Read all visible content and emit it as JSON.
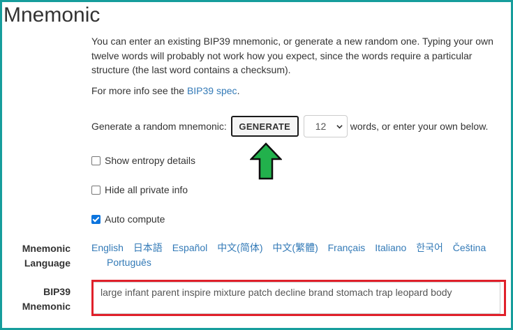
{
  "section": {
    "title": "Mnemonic"
  },
  "intro": {
    "text": "You can enter an existing BIP39 mnemonic, or generate a new random one. Typing your own twelve words will probably not work how you expect, since the words require a particular structure (the last word contains a checksum).",
    "more_info_prefix": "For more info see the ",
    "more_info_link": "BIP39 spec",
    "more_info_suffix": "."
  },
  "generate": {
    "prefix": "Generate a random mnemonic:",
    "button_label": "GENERATE",
    "word_count": "12",
    "suffix": "words, or enter your own below."
  },
  "options": [
    {
      "label": "Show entropy details",
      "checked": false
    },
    {
      "label": "Hide all private info",
      "checked": false
    },
    {
      "label": "Auto compute",
      "checked": true
    }
  ],
  "language": {
    "label_line1": "Mnemonic",
    "label_line2": "Language",
    "links": [
      "English",
      "日本語",
      "Español",
      "中文(简体)",
      "中文(繁體)",
      "Français",
      "Italiano",
      "한국어",
      "Čeština",
      "Português"
    ]
  },
  "mnemonic": {
    "label_line1": "BIP39",
    "label_line2": "Mnemonic",
    "value": "large infant parent inspire mixture patch decline brand stomach trap leopard body"
  },
  "annotations": {
    "frame_color": "#169d9c",
    "arrow_color": "#22b14c",
    "highlight_color": "#e0202a"
  }
}
